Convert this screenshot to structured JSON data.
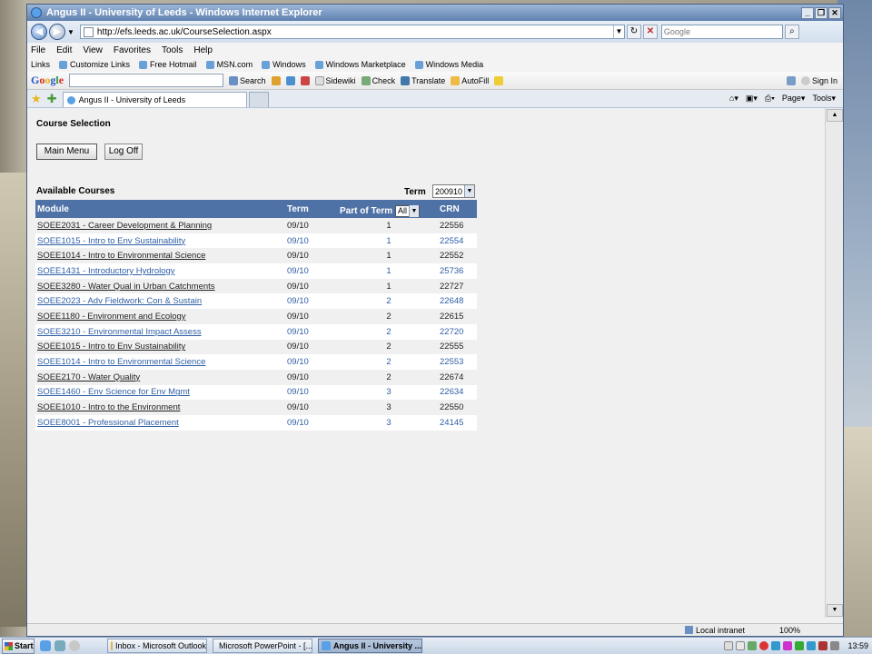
{
  "window": {
    "title": "Angus II - University of Leeds - Windows Internet Explorer",
    "address": "http://efs.leeds.ac.uk/CourseSelection.aspx",
    "search_placeholder": "Google"
  },
  "menu": [
    "File",
    "Edit",
    "View",
    "Favorites",
    "Tools",
    "Help"
  ],
  "links_bar": {
    "label": "Links",
    "items": [
      "Customize Links",
      "Free Hotmail",
      "MSN.com",
      "Windows",
      "Windows Marketplace",
      "Windows Media"
    ]
  },
  "google_bar": {
    "logo": [
      "G",
      "o",
      "o",
      "g",
      "l",
      "e"
    ],
    "search": "Search",
    "sidewiki": "Sidewiki",
    "check": "Check",
    "translate": "Translate",
    "autofill": "AutoFill",
    "sign_in": "Sign In"
  },
  "tab": {
    "title": "Angus II - University of Leeds"
  },
  "command_bar": {
    "page": "Page",
    "tools": "Tools"
  },
  "page": {
    "heading": "Course Selection",
    "main_menu": "Main Menu",
    "log_off": "Log Off",
    "available_courses": "Available Courses",
    "term_label": "Term",
    "term_value": "200910",
    "columns": {
      "module": "Module",
      "term": "Term",
      "part": "Part of Term",
      "part_filter": "All",
      "crn": "CRN"
    },
    "courses": [
      {
        "module": "SOEE2031 - Career Development & Planning",
        "term": "09/10",
        "part": "1",
        "crn": "22556"
      },
      {
        "module": "SOEE1015 - Intro to Env Sustainability",
        "term": "09/10",
        "part": "1",
        "crn": "22554"
      },
      {
        "module": "SOEE1014 - Intro to Environmental Science",
        "term": "09/10",
        "part": "1",
        "crn": "22552"
      },
      {
        "module": "SOEE1431 - Introductory Hydrology",
        "term": "09/10",
        "part": "1",
        "crn": "25736"
      },
      {
        "module": "SOEE3280 - Water Qual in Urban Catchments",
        "term": "09/10",
        "part": "1",
        "crn": "22727"
      },
      {
        "module": "SOEE2023 - Adv Fieldwork: Con & Sustain",
        "term": "09/10",
        "part": "2",
        "crn": "22648"
      },
      {
        "module": "SOEE1180 - Environment and Ecology",
        "term": "09/10",
        "part": "2",
        "crn": "22615"
      },
      {
        "module": "SOEE3210 - Environmental Impact Assess",
        "term": "09/10",
        "part": "2",
        "crn": "22720"
      },
      {
        "module": "SOEE1015 - Intro to Env Sustainability",
        "term": "09/10",
        "part": "2",
        "crn": "22555"
      },
      {
        "module": "SOEE1014 - Intro to Environmental Science",
        "term": "09/10",
        "part": "2",
        "crn": "22553"
      },
      {
        "module": "SOEE2170 - Water Quality",
        "term": "09/10",
        "part": "2",
        "crn": "22674"
      },
      {
        "module": "SOEE1460 - Env Science for Env Mgmt",
        "term": "09/10",
        "part": "3",
        "crn": "22634"
      },
      {
        "module": "SOEE1010 - Intro to the Environment",
        "term": "09/10",
        "part": "3",
        "crn": "22550"
      },
      {
        "module": "SOEE8001 - Professional Placement",
        "term": "09/10",
        "part": "3",
        "crn": "24145"
      }
    ]
  },
  "status": {
    "zone": "Local intranet",
    "zoom": "100%"
  },
  "taskbar": {
    "start": "Start",
    "tasks": [
      "Inbox - Microsoft Outlook",
      "Microsoft PowerPoint - [...",
      "Angus II - University ..."
    ],
    "clock": "13:59"
  },
  "colors": {
    "header": "#4f72a6",
    "link": "#2f5fa5",
    "titlebar": "#5f80b0"
  }
}
